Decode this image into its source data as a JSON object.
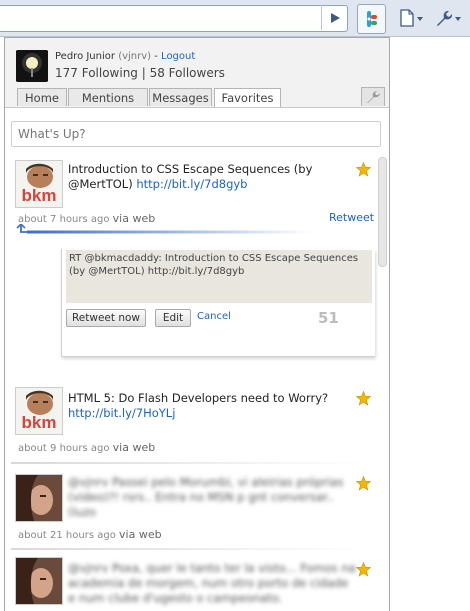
{
  "browser": {
    "icons": [
      "go-arrow-icon",
      "extension-icon",
      "page-menu-icon",
      "wrench-menu-icon"
    ]
  },
  "header": {
    "display_name": "Pedro Junior",
    "handle": "(vjnrv)",
    "separator": "-",
    "logout_label": "Logout",
    "stats": "177 Following | 58 Followers"
  },
  "tabs": [
    {
      "label": "Home"
    },
    {
      "label": "Mentions"
    },
    {
      "label": "Messages"
    },
    {
      "label": "Favorites",
      "active": true
    }
  ],
  "compose": {
    "placeholder": "What's Up?"
  },
  "tweets": [
    {
      "text": "Introduction to CSS Escape Sequences (by @MertTOL)",
      "link": "http://bit.ly/7d8gyb",
      "time": "about 7 hours ago",
      "via": "via web",
      "retweet_label": "Retweet",
      "favorited": true
    },
    {
      "text": "HTML 5: Do Flash Developers need to Worry?",
      "link": "http://bit.ly/7HoYLj",
      "time": "about 9 hours ago",
      "via": "via web",
      "favorited": true
    },
    {
      "text": "@vjnrv Passei pelo Morumbi, vi aleirias próprias (video)?! rsrs.. Entra no MSN p gnt conversar.. (luzo",
      "time": "about 21 hours ago",
      "via": "via web",
      "favorited": true
    },
    {
      "text": "@vjnrv Poxa, quer le tanto ter la visto... Fomos na academia de morgem, num otro porto de cidade e num clube d'ugesto o campeonato.",
      "favorited": true
    }
  ],
  "retweet_box": {
    "text": "RT @bkmacdaddy: Introduction to CSS Escape Sequences (by @MertTOL) http://bit.ly/7d8gyb",
    "retweet_now_label": "Retweet now",
    "edit_label": "Edit",
    "cancel_label": "Cancel",
    "char_count": "51"
  },
  "colors": {
    "link": "#1a63c6",
    "star": "#f2b705",
    "toolbar": "#dfe6ef"
  }
}
